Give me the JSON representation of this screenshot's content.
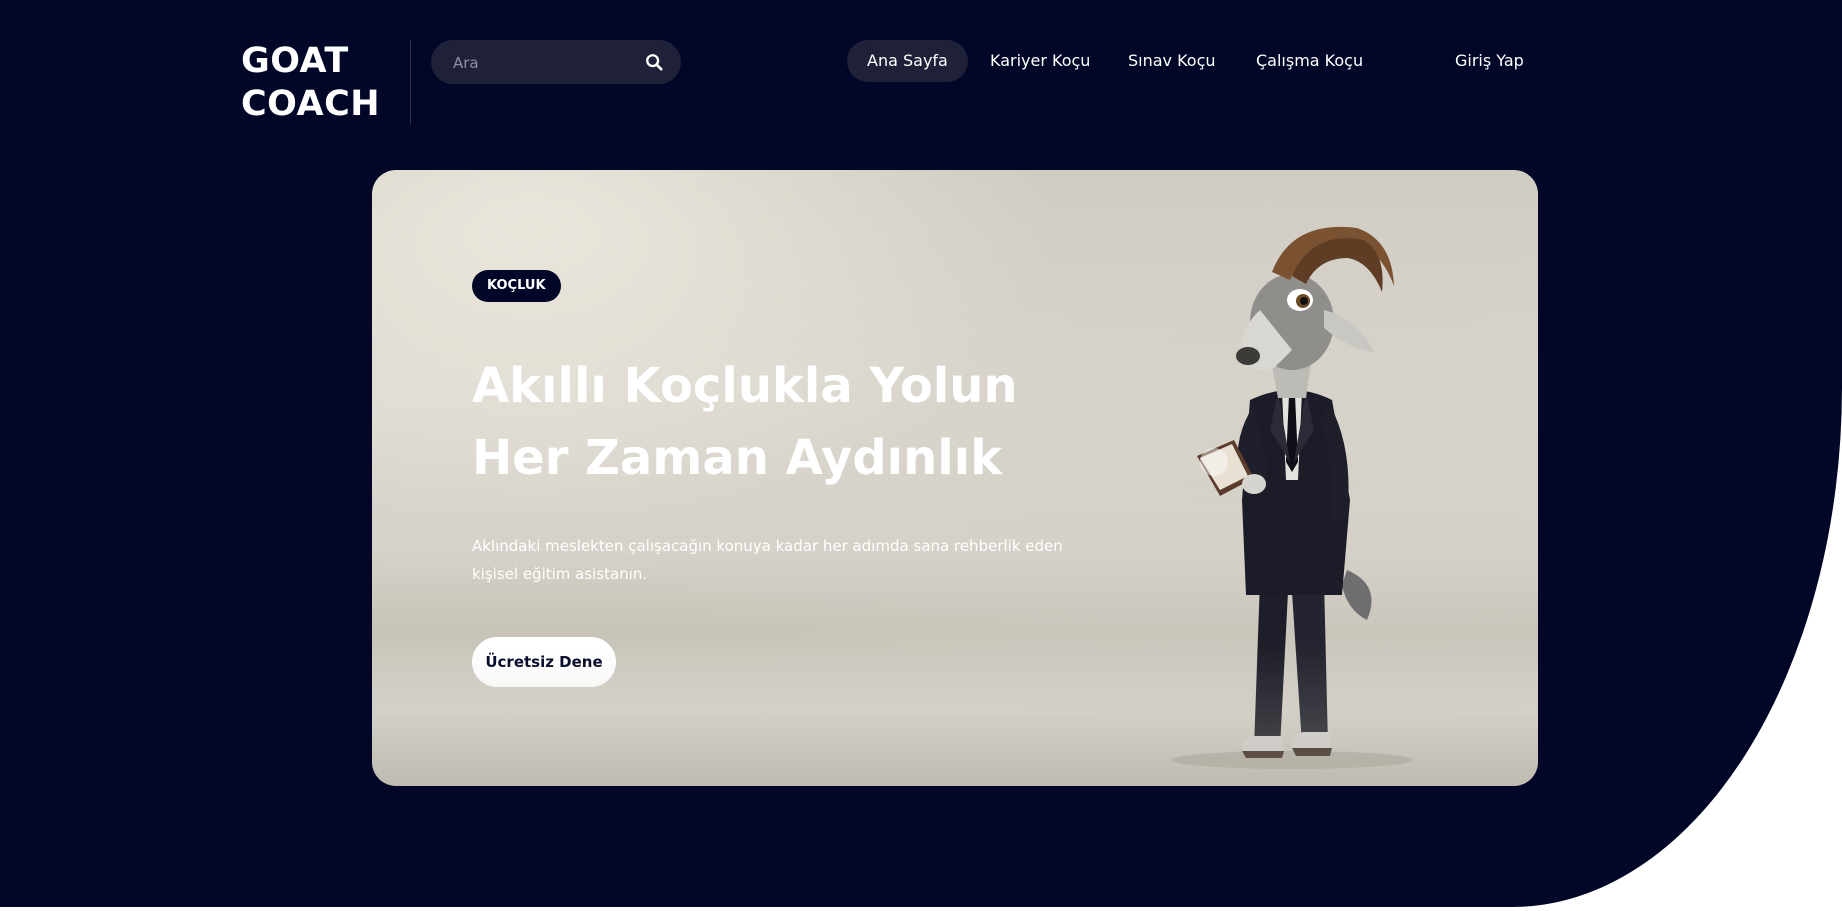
{
  "header": {
    "logo_line1": "GOAT",
    "logo_line2": "COACH",
    "search": {
      "placeholder": "Ara",
      "icon": "search-icon"
    },
    "nav": [
      {
        "label": "Ana Sayfa",
        "active": true
      },
      {
        "label": "Kariyer Koçu",
        "active": false
      },
      {
        "label": "Sınav Koçu",
        "active": false
      },
      {
        "label": "Çalışma Koçu",
        "active": false
      }
    ],
    "login_label": "Giriş Yap"
  },
  "hero": {
    "tag": "KOÇLUK",
    "title_line1": "Akıllı Koçlukla Yolun",
    "title_line2": "Her Zaman Aydınlık",
    "description": "Aklındaki meslekten çalışacağın konuya kadar her adımda sana rehberlik eden kişisel eğitim asistanın.",
    "cta_label": "Ücretsiz Dene",
    "illustration": "goat-in-suit-holding-book"
  },
  "colors": {
    "background": "#020728",
    "nav_active_bg": "#1e2138",
    "text": "#ffffff"
  }
}
